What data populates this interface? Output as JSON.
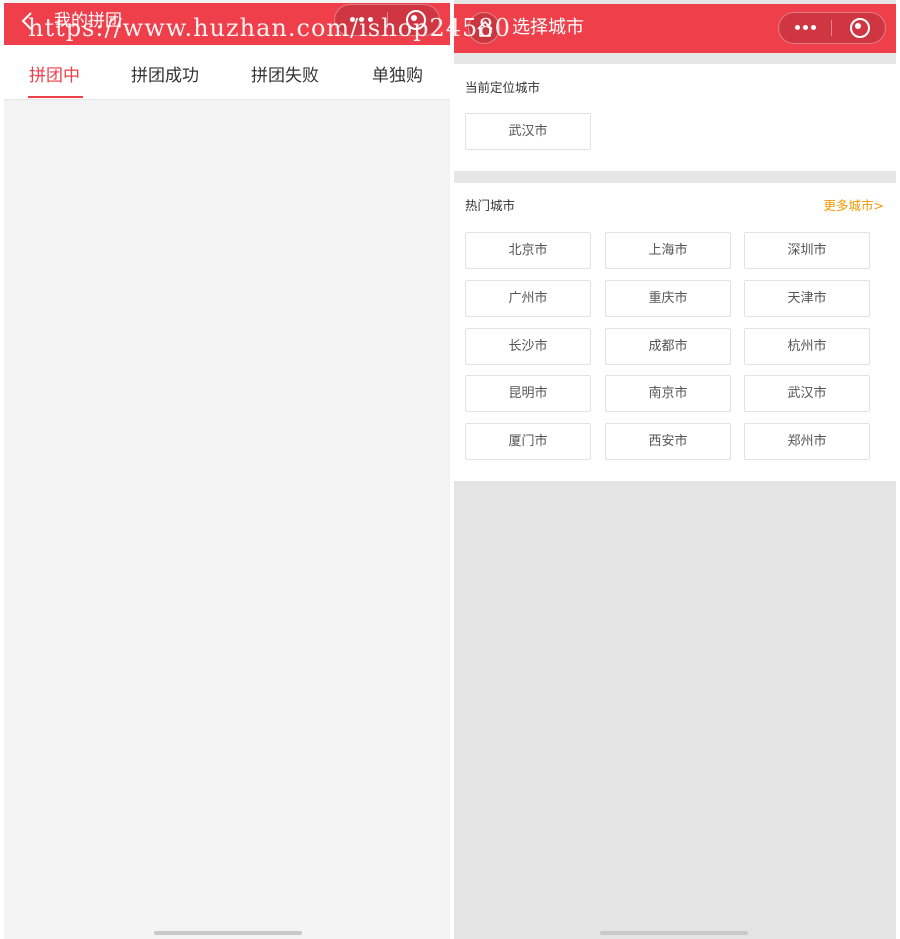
{
  "watermark": "https://www.huzhan.com/ishop24580",
  "left": {
    "title": "我的拼团",
    "tabs": [
      "拼团中",
      "拼团成功",
      "拼团失败",
      "单独购"
    ],
    "active_tab": 0
  },
  "right": {
    "title": "选择城市",
    "current": {
      "title": "当前定位城市",
      "city": "武汉市"
    },
    "hot": {
      "title": "热门城市",
      "more": "更多城市>",
      "cities": [
        [
          "北京市",
          "上海市",
          "深圳市"
        ],
        [
          "广州市",
          "重庆市",
          "天津市"
        ],
        [
          "长沙市",
          "成都市",
          "杭州市"
        ],
        [
          "昆明市",
          "南京市",
          "武汉市"
        ],
        [
          "厦门市",
          "西安市",
          "郑州市"
        ]
      ]
    }
  },
  "colors": {
    "brand_red": "#ee3f4b",
    "accent_orange": "#f39700",
    "background_gray": "#f3f3f3"
  },
  "icons": [
    "back-icon",
    "more-dots-icon",
    "close-target-icon",
    "home-icon"
  ]
}
